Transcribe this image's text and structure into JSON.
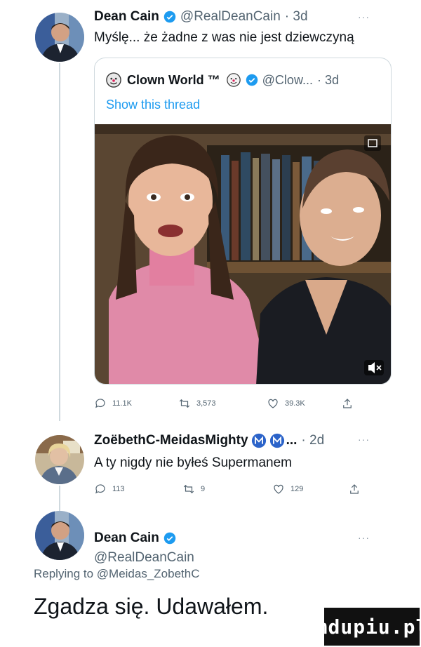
{
  "tweet1": {
    "name": "Dean Cain",
    "handle": "@RealDeanCain",
    "time": "· 3d",
    "more": "···",
    "text": "Myślę... że żadne z was nie jest dziewczyną"
  },
  "quote": {
    "name": "Clown World ™",
    "handle": "@Clow...",
    "time": "· 3d",
    "show_thread": "Show this thread"
  },
  "tweet1_actions": {
    "replies": "11.1K",
    "retweets": "3,573",
    "likes": "39.3K"
  },
  "tweet2": {
    "name": "ZoëbethC-MeidasMighty",
    "suffix": "...",
    "time": "· 2d",
    "more": "···",
    "text": "A ty nigdy nie byłeś Supermanem",
    "replies": "113",
    "retweets": "9",
    "likes": "129"
  },
  "tweet3": {
    "name": "Dean Cain",
    "handle": "@RealDeanCain",
    "more": "···",
    "replying_prefix": "Replying to ",
    "replying_handle": "@Meidas_ZobethC",
    "text": "Zgadza się. Udawałem."
  },
  "watermark": "mdupiu.pl",
  "colors": {
    "accent": "#1d9bf0",
    "meta": "#536471",
    "line": "#cfd9de"
  }
}
